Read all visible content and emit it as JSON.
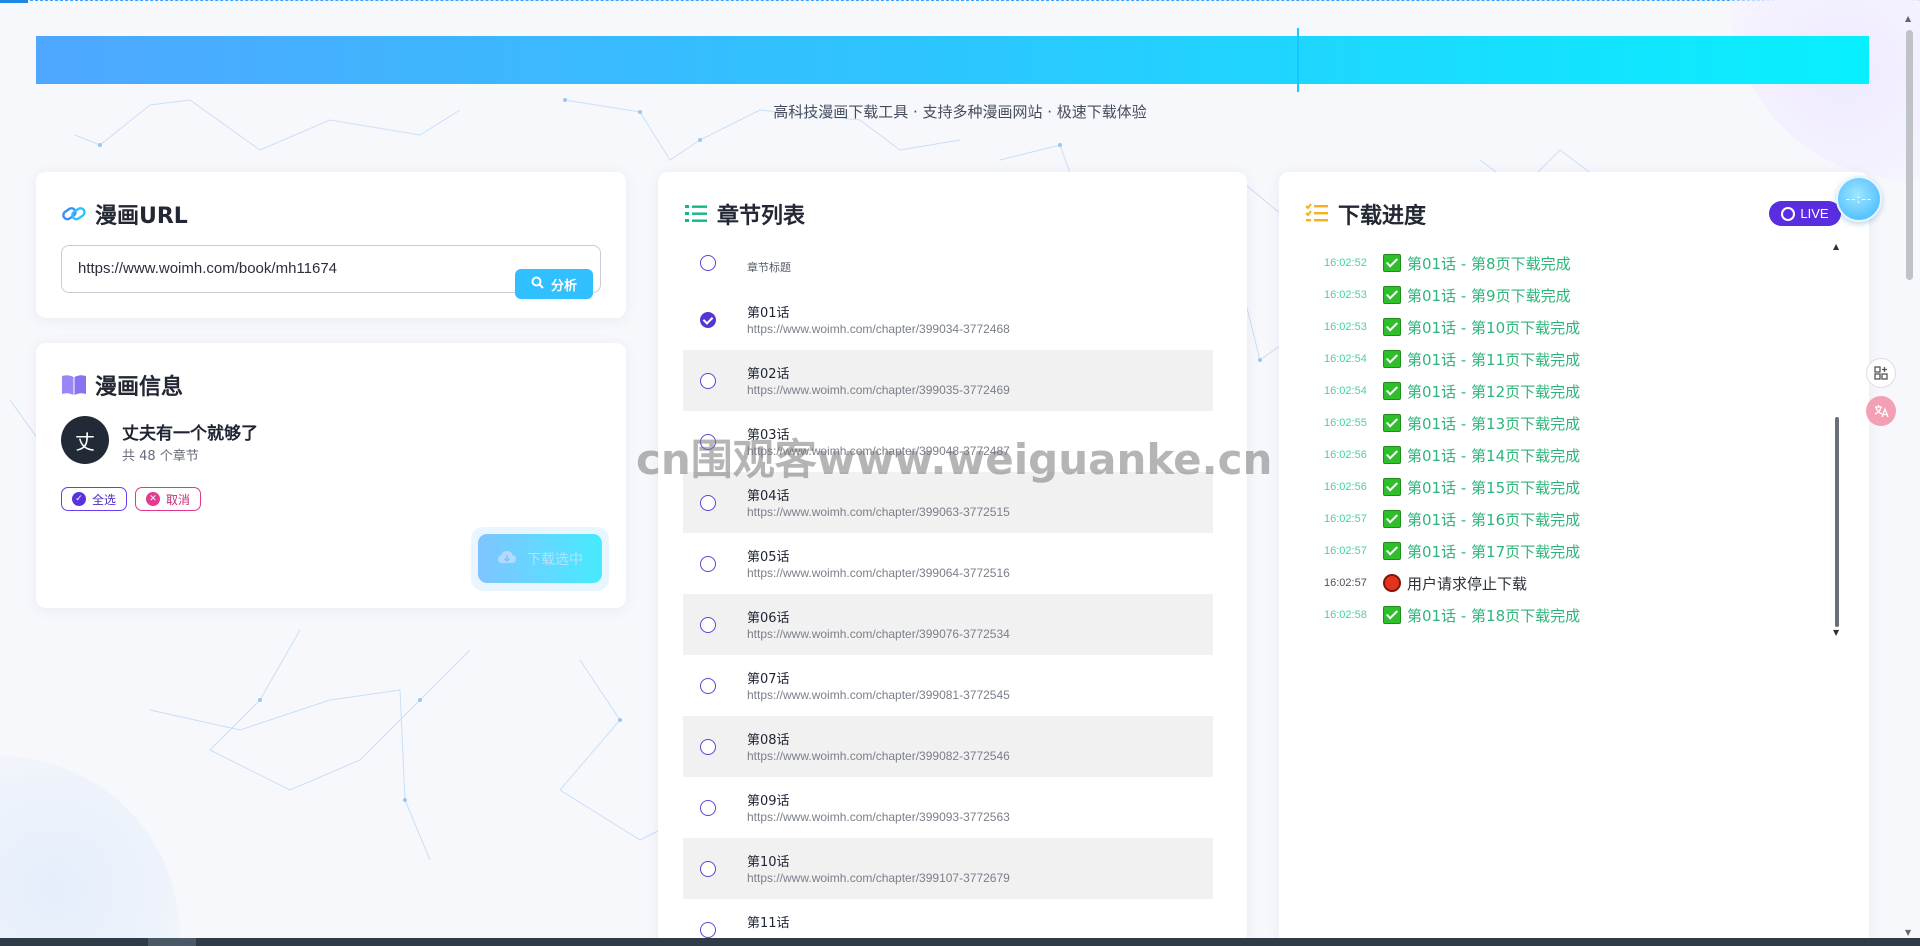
{
  "subtitle": "高科技漫画下载工具 · 支持多种漫画网站 · 极速下载体验",
  "url_card": {
    "title": "漫画URL",
    "url_value": "https://www.woimh.com/book/mh11674",
    "analyze_label": "分析"
  },
  "info_card": {
    "title": "漫画信息",
    "avatar_letter": "丈",
    "comic_name": "丈夫有一个就够了",
    "chapter_count": "共 48 个章节",
    "select_all_label": "全选",
    "cancel_label": "取消",
    "download_selected_label": "下载选中"
  },
  "chapter_card": {
    "title": "章节列表",
    "header_label": "章节标题",
    "chapters": [
      {
        "title": "第01话",
        "url": "https://www.woimh.com/chapter/399034-3772468",
        "checked": true
      },
      {
        "title": "第02话",
        "url": "https://www.woimh.com/chapter/399035-3772469",
        "checked": false
      },
      {
        "title": "第03话",
        "url": "https://www.woimh.com/chapter/399048-3772487",
        "checked": false
      },
      {
        "title": "第04话",
        "url": "https://www.woimh.com/chapter/399063-3772515",
        "checked": false
      },
      {
        "title": "第05话",
        "url": "https://www.woimh.com/chapter/399064-3772516",
        "checked": false
      },
      {
        "title": "第06话",
        "url": "https://www.woimh.com/chapter/399076-3772534",
        "checked": false
      },
      {
        "title": "第07话",
        "url": "https://www.woimh.com/chapter/399081-3772545",
        "checked": false
      },
      {
        "title": "第08话",
        "url": "https://www.woimh.com/chapter/399082-3772546",
        "checked": false
      },
      {
        "title": "第09话",
        "url": "https://www.woimh.com/chapter/399093-3772563",
        "checked": false
      },
      {
        "title": "第10话",
        "url": "https://www.woimh.com/chapter/399107-3772679",
        "checked": false
      },
      {
        "title": "第11话",
        "url": "",
        "checked": false
      }
    ]
  },
  "progress_card": {
    "title": "下载进度",
    "live_label": "LIVE",
    "logs": [
      {
        "time": "16:02:52",
        "text": "第01话 - 第8页下载完成",
        "status": "done"
      },
      {
        "time": "16:02:53",
        "text": "第01话 - 第9页下载完成",
        "status": "done"
      },
      {
        "time": "16:02:53",
        "text": "第01话 - 第10页下载完成",
        "status": "done"
      },
      {
        "time": "16:02:54",
        "text": "第01话 - 第11页下载完成",
        "status": "done"
      },
      {
        "time": "16:02:54",
        "text": "第01话 - 第12页下载完成",
        "status": "done"
      },
      {
        "time": "16:02:55",
        "text": "第01话 - 第13页下载完成",
        "status": "done"
      },
      {
        "time": "16:02:56",
        "text": "第01话 - 第14页下载完成",
        "status": "done"
      },
      {
        "time": "16:02:56",
        "text": "第01话 - 第15页下载完成",
        "status": "done"
      },
      {
        "time": "16:02:57",
        "text": "第01话 - 第16页下载完成",
        "status": "done"
      },
      {
        "time": "16:02:57",
        "text": "第01话 - 第17页下载完成",
        "status": "done"
      },
      {
        "time": "16:02:57",
        "text": "用户请求停止下载",
        "status": "stop"
      },
      {
        "time": "16:02:58",
        "text": "第01话 - 第18页下载完成",
        "status": "done"
      }
    ]
  },
  "float_button_label": "--:--",
  "watermark": "cn围观客www.weiguanke.cn",
  "colors": {
    "accent_purple": "#5535d6",
    "banner_start": "#4fa7ff",
    "banner_end": "#08f0ff",
    "success_green": "#2db579",
    "stop_red": "#e5321b"
  },
  "icons": {
    "url_title": "link-icon",
    "info_title": "book-icon",
    "chapter_title": "list-icon",
    "progress_title": "checklist-icon",
    "analyze": "search-icon",
    "download": "cloud-download-icon"
  }
}
